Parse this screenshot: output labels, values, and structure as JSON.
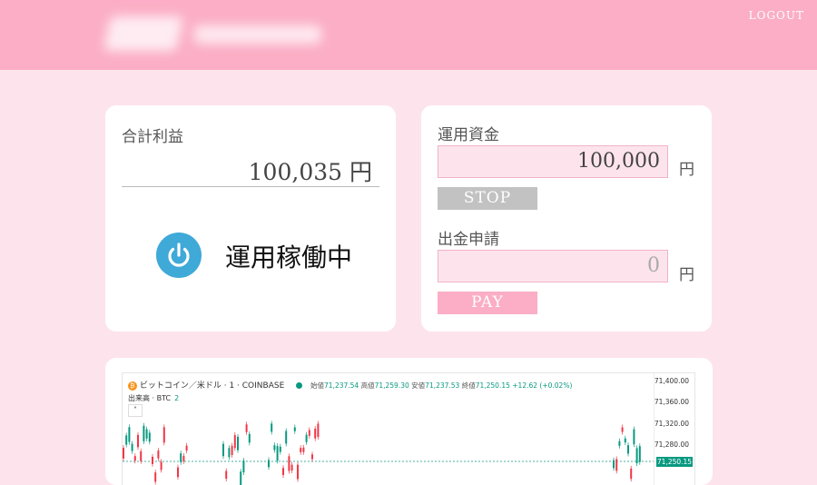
{
  "header": {
    "logout_label": "LOGOUT"
  },
  "summary": {
    "total_profit_label": "合計利益",
    "total_profit_value": "100,035 円",
    "status_text": "運用稼働中"
  },
  "controls": {
    "capital_label": "運用資金",
    "capital_value": "100,000",
    "capital_unit": "円",
    "stop_label": "STOP",
    "withdraw_label": "出金申請",
    "withdraw_placeholder": "0",
    "withdraw_unit": "円",
    "pay_label": "PAY"
  },
  "chart": {
    "symbol_title": "ビットコイン／米ドル · 1 · COINBASE",
    "open_label": "始値",
    "open_value": "71,237.54",
    "high_label": "高値",
    "high_value": "71,259.30",
    "low_label": "安値",
    "low_value": "71,237.53",
    "close_label": "終値",
    "close_value": "71,250.15",
    "change_value": "+12.62 (+0.02%)",
    "volume_label": "出来高 · BTC",
    "volume_value": "2",
    "collapse_glyph": "˄",
    "btc_glyph": "₿",
    "y_ticks": [
      "71,400.00",
      "71,360.00",
      "71,320.00",
      "71,280.00"
    ],
    "last_price": "71,250.15",
    "colors": {
      "up": "#089981",
      "down": "#f23645"
    }
  },
  "chart_data": {
    "type": "candlestick",
    "y_axis_ticks": [
      71400,
      71360,
      71320,
      71280
    ],
    "last_price": 71250.15,
    "ohlc_latest": {
      "open": 71237.54,
      "high": 71259.3,
      "low": 71237.53,
      "close": 71250.15
    }
  }
}
